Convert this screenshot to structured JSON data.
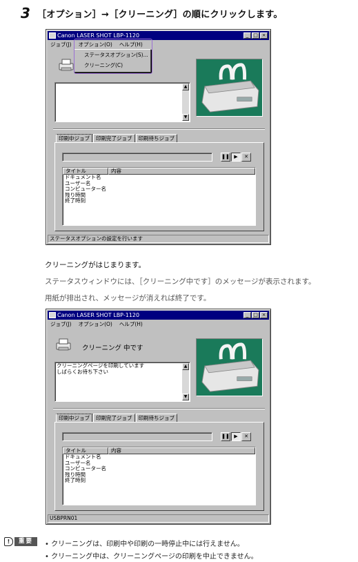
{
  "step": {
    "number": "3",
    "text": "［オプション］→［クリーニング］の順にクリックします。"
  },
  "window1": {
    "title": "Canon LASER SHOT LBP-1120",
    "title_buttons": [
      "_",
      "□",
      "×"
    ],
    "menu": [
      "ジョブ(J)",
      "オプション(O)",
      "ヘルプ(H)"
    ],
    "dropdown_items": [
      "ステータスオプション(S)...",
      "クリーニング(C)"
    ],
    "status_message": "",
    "message_lines": [],
    "tabs": [
      "印刷中ジョブ",
      "印刷完了ジョブ",
      "印刷待ちジョブ"
    ],
    "list_columns": [
      "タイトル",
      "内容"
    ],
    "list_rows": [
      "ドキュメント名",
      "ユーザー名",
      "コンピューター名",
      "残り時間",
      "終了時刻"
    ],
    "statusbar": "ステータスオプションの設定を行います"
  },
  "paragraphs": [
    "クリーニングがはじまります。",
    "ステータスウィンドウには、［クリーニング中です］のメッセージが表示されます。",
    "用紙が排出され、メッセージが消えれば終了です。"
  ],
  "window2": {
    "title": "Canon LASER SHOT LBP-1120",
    "title_buttons": [
      "_",
      "□",
      "×"
    ],
    "menu": [
      "ジョブ(J)",
      "オプション(O)",
      "ヘルプ(H)"
    ],
    "status_message": "クリーニング 中です",
    "message_lines": [
      "クリーニングページを印刷しています",
      "しばらくお待ち下さい"
    ],
    "tabs": [
      "印刷中ジョブ",
      "印刷完了ジョブ",
      "印刷待ちジョブ"
    ],
    "list_columns": [
      "タイトル",
      "内容"
    ],
    "list_rows": [
      "ドキュメント名",
      "ユーザー名",
      "コンピューター名",
      "残り時間",
      "終了時刻"
    ],
    "statusbar": "USBPRN01"
  },
  "important": {
    "icon": "!",
    "label": "重要",
    "notes": [
      "• クリーニングは、印刷中や印刷の一時停止中には行えません。",
      "• クリーニング中は、クリーニングページの印刷を中止できません。"
    ]
  },
  "colors": {
    "titlebar": "#000080",
    "window_face": "#c0c0c0",
    "picture_bg": "#1a7a5a",
    "highlight": "#9b6fd4"
  },
  "icons": {
    "printer": "printer-icon",
    "scroll_up": "scroll-up-arrow-icon",
    "scroll_down": "scroll-down-arrow-icon",
    "pause": "pause-icon",
    "play": "play-icon",
    "cancel": "cancel-job-icon",
    "important": "exclamation-icon"
  }
}
